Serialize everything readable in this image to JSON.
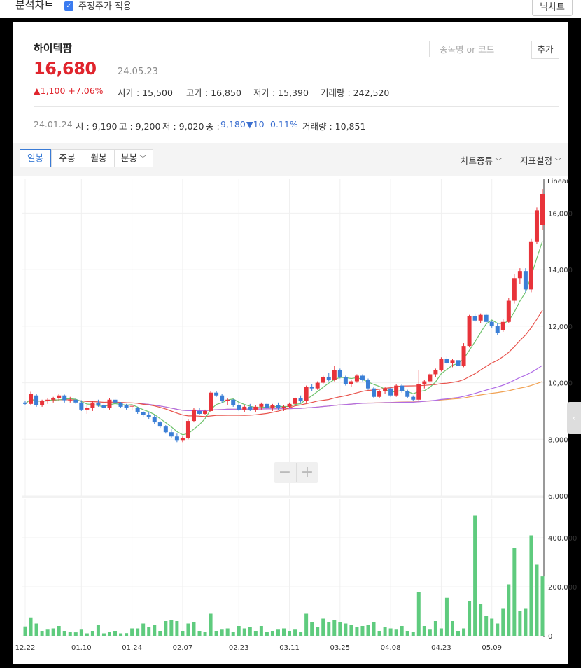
{
  "topbar": {
    "title": "분석차트",
    "checkbox_label": "주정주가 적용",
    "right_button": "닉차트"
  },
  "stock": {
    "name": "하이텍팜",
    "price": "16,680",
    "date": "24.05.23",
    "change": "▲1,100 +7.06%",
    "open": "시가 : 15,500",
    "high": "고가 : 16,850",
    "low": "저가 : 15,390",
    "volume": "거래량 : 242,520"
  },
  "search": {
    "placeholder": "종목명 or 코드",
    "add_label": "추가"
  },
  "crosshair": {
    "date": "24.01.24",
    "open": "시 : 9,190",
    "high": "고 : 9,200",
    "low": "저 : 9,020",
    "close_label": "종 :",
    "close_value": "9,180",
    "change": "▼10 -0.11%",
    "volume": "거래량 : 10,851"
  },
  "toolbar": {
    "tabs": [
      "일봉",
      "주봉",
      "월봉",
      "분봉"
    ],
    "chart_type": "차트종류",
    "indicator": "지표설정"
  },
  "colors": {
    "up": "#e8333a",
    "down": "#3b7fd6",
    "volume": "#5fcb7e",
    "ma5": "#6fc36d",
    "ma20": "#e8534c",
    "ma60": "#b06ce6",
    "ma120": "#f0a050"
  },
  "chart_data": {
    "type": "candlestick",
    "scale_label": "Linear",
    "price_ylim": [
      6000,
      17200
    ],
    "price_ticks": [
      "6,000",
      "8,000",
      "10,000",
      "12,000",
      "14,000",
      "16,000"
    ],
    "volume_ylim": [
      0,
      560000
    ],
    "volume_ticks": [
      "0",
      "200,000",
      "400,000"
    ],
    "x_ticks": [
      "12.22",
      "01.10",
      "01.24",
      "02.07",
      "02.23",
      "03.11",
      "03.25",
      "04.08",
      "04.23",
      "05.09"
    ],
    "candles": [
      [
        9300,
        9350,
        9200,
        9250
      ],
      [
        9250,
        9680,
        9200,
        9600
      ],
      [
        9550,
        9600,
        9150,
        9200
      ],
      [
        9220,
        9400,
        9150,
        9350
      ],
      [
        9350,
        9450,
        9250,
        9400
      ],
      [
        9400,
        9500,
        9300,
        9450
      ],
      [
        9450,
        9600,
        9350,
        9550
      ],
      [
        9550,
        9580,
        9300,
        9380
      ],
      [
        9380,
        9500,
        9300,
        9400
      ],
      [
        9400,
        9450,
        9250,
        9300
      ],
      [
        9300,
        9380,
        9000,
        9050
      ],
      [
        9050,
        9200,
        8900,
        9100
      ],
      [
        9100,
        9350,
        9000,
        9300
      ],
      [
        9300,
        9400,
        9150,
        9200
      ],
      [
        9200,
        9300,
        9050,
        9100
      ],
      [
        9100,
        9450,
        9050,
        9400
      ],
      [
        9400,
        9450,
        9250,
        9300
      ],
      [
        9300,
        9320,
        9100,
        9150
      ],
      [
        9200,
        9250,
        9050,
        9100
      ],
      [
        9180,
        9200,
        9020,
        9180
      ],
      [
        9100,
        9150,
        8900,
        8950
      ],
      [
        8950,
        9000,
        8800,
        8850
      ],
      [
        8850,
        8950,
        8700,
        8800
      ],
      [
        8800,
        8850,
        8550,
        8600
      ],
      [
        8600,
        8650,
        8400,
        8450
      ],
      [
        8450,
        8500,
        8200,
        8250
      ],
      [
        8250,
        8350,
        8050,
        8100
      ],
      [
        8100,
        8200,
        7900,
        7950
      ],
      [
        7950,
        8100,
        7900,
        8050
      ],
      [
        8050,
        8700,
        8000,
        8650
      ],
      [
        8650,
        9100,
        8600,
        9050
      ],
      [
        9000,
        9100,
        8850,
        8900
      ],
      [
        8900,
        9050,
        8850,
        9000
      ],
      [
        9000,
        9700,
        8950,
        9650
      ],
      [
        9650,
        9700,
        9500,
        9550
      ],
      [
        9550,
        9600,
        9300,
        9350
      ],
      [
        9350,
        9450,
        9200,
        9400
      ],
      [
        9400,
        9420,
        9150,
        9200
      ],
      [
        9200,
        9280,
        9000,
        9050
      ],
      [
        9050,
        9200,
        8950,
        9150
      ],
      [
        9150,
        9250,
        9000,
        9050
      ],
      [
        9050,
        9200,
        8950,
        9150
      ],
      [
        9150,
        9300,
        9050,
        9250
      ],
      [
        9250,
        9300,
        9050,
        9100
      ],
      [
        9100,
        9250,
        9000,
        9200
      ],
      [
        9200,
        9300,
        9050,
        9100
      ],
      [
        9100,
        9200,
        9000,
        9150
      ],
      [
        9150,
        9300,
        9100,
        9250
      ],
      [
        9250,
        9500,
        9200,
        9450
      ],
      [
        9450,
        9550,
        9300,
        9350
      ],
      [
        9350,
        9900,
        9300,
        9850
      ],
      [
        9850,
        9950,
        9700,
        9800
      ],
      [
        9800,
        10050,
        9750,
        10000
      ],
      [
        10000,
        10250,
        9950,
        10200
      ],
      [
        10200,
        10350,
        10050,
        10100
      ],
      [
        10100,
        10600,
        10050,
        10450
      ],
      [
        10450,
        10500,
        10150,
        10200
      ],
      [
        10200,
        10250,
        9900,
        9950
      ],
      [
        9950,
        10100,
        9850,
        10050
      ],
      [
        10050,
        10300,
        10000,
        10250
      ],
      [
        10250,
        10300,
        10050,
        10100
      ],
      [
        10100,
        10150,
        9750,
        9800
      ],
      [
        9800,
        9850,
        9450,
        9500
      ],
      [
        9500,
        9750,
        9450,
        9700
      ],
      [
        9700,
        9850,
        9600,
        9800
      ],
      [
        9800,
        9850,
        9500,
        9550
      ],
      [
        9550,
        9950,
        9500,
        9900
      ],
      [
        9900,
        9950,
        9650,
        9700
      ],
      [
        9700,
        9750,
        9450,
        9500
      ],
      [
        9500,
        9550,
        9350,
        9400
      ],
      [
        9400,
        10450,
        9350,
        9950
      ],
      [
        9950,
        10100,
        9800,
        10050
      ],
      [
        10050,
        10350,
        10000,
        10300
      ],
      [
        10300,
        10500,
        10200,
        10450
      ],
      [
        10450,
        10900,
        10400,
        10850
      ],
      [
        10850,
        10950,
        10650,
        10700
      ],
      [
        10700,
        10850,
        10550,
        10800
      ],
      [
        10800,
        10900,
        10550,
        10600
      ],
      [
        10600,
        11400,
        10550,
        11300
      ],
      [
        11300,
        12400,
        11250,
        12350
      ],
      [
        12350,
        12450,
        12150,
        12200
      ],
      [
        12200,
        12450,
        12100,
        12400
      ],
      [
        12400,
        12450,
        12100,
        12150
      ],
      [
        12150,
        12200,
        11950,
        12000
      ],
      [
        12000,
        12100,
        11700,
        11750
      ],
      [
        11850,
        12250,
        11800,
        12150
      ],
      [
        12150,
        13000,
        12100,
        12900
      ],
      [
        12900,
        13850,
        12800,
        13700
      ],
      [
        13700,
        14050,
        13500,
        13950
      ],
      [
        13950,
        14050,
        13200,
        13300
      ],
      [
        13300,
        15100,
        13200,
        15000
      ],
      [
        15000,
        16200,
        14900,
        16100
      ],
      [
        15580,
        16850,
        15390,
        16680
      ]
    ],
    "volume": [
      38000,
      75000,
      50000,
      20000,
      25000,
      30000,
      40000,
      20000,
      15000,
      14000,
      25000,
      10000,
      20000,
      45000,
      10000,
      15000,
      20000,
      10000,
      10851,
      30000,
      30000,
      50000,
      35000,
      45000,
      20000,
      60000,
      65000,
      60000,
      20000,
      50000,
      55000,
      20000,
      15000,
      90000,
      20000,
      25000,
      30000,
      15000,
      40000,
      30000,
      35000,
      20000,
      40000,
      15000,
      20000,
      25000,
      30000,
      20000,
      25000,
      15000,
      90000,
      55000,
      35000,
      70000,
      55000,
      65000,
      55000,
      50000,
      45000,
      35000,
      40000,
      45000,
      55000,
      20000,
      35000,
      30000,
      25000,
      40000,
      20000,
      15000,
      180000,
      40000,
      25000,
      60000,
      30000,
      155000,
      60000,
      20000,
      30000,
      140000,
      490000,
      130000,
      80000,
      70000,
      50000,
      110000,
      210000,
      360000,
      100000,
      110000,
      410000,
      290000,
      242520
    ]
  }
}
